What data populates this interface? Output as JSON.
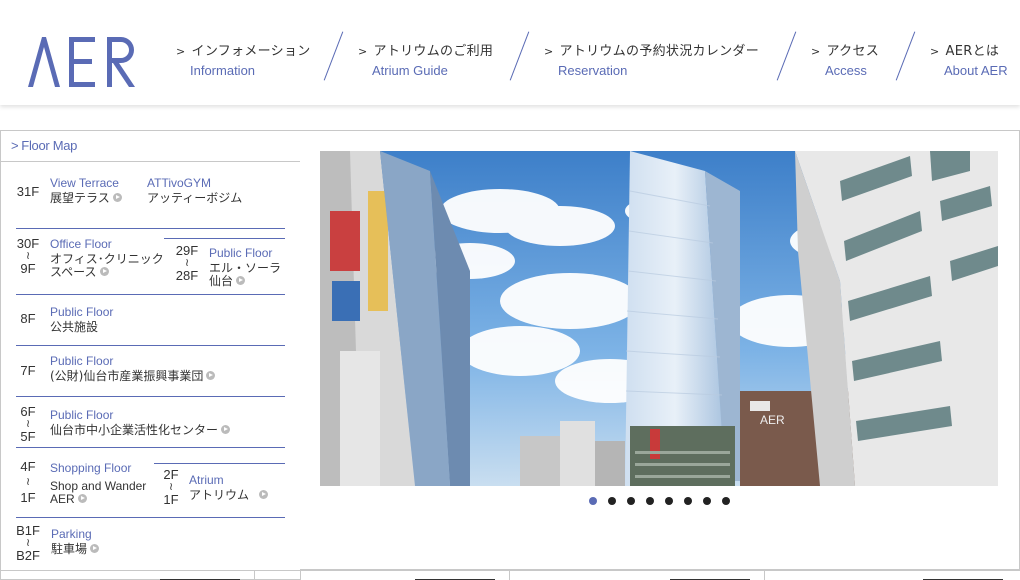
{
  "header": {
    "logo_text": "AER",
    "nav": [
      {
        "jp": "インフォメーション",
        "en": "Information"
      },
      {
        "jp": "アトリウムのご利用",
        "en": "Atrium Guide"
      },
      {
        "jp": "アトリウムの予約状況カレンダー",
        "en": "Reservation"
      },
      {
        "jp": "アクセス",
        "en": "Access"
      },
      {
        "jp": "AERとは",
        "en": "About AER"
      }
    ],
    "nav_arrow": ">"
  },
  "floor_map": {
    "title": "Floor Map",
    "title_arrow": ">",
    "tilde": "≀",
    "f31": {
      "floor": "31F",
      "items": [
        {
          "cat": "View Terrace",
          "name": "展望テラス"
        },
        {
          "cat": "ATTivoGYM",
          "name": "アッティーボジム"
        }
      ]
    },
    "f30": {
      "top": "30F",
      "bottom": "9F",
      "cat": "Office Floor",
      "name1": "オフィス･クリニック",
      "name2": "スペース"
    },
    "f29": {
      "top": "29F",
      "bottom": "28F",
      "cat": "Public Floor",
      "name1": "エル・ソーラ",
      "name2": "仙台"
    },
    "f8": {
      "floor": "8F",
      "cat": "Public Floor",
      "name": "公共施設"
    },
    "f7": {
      "floor": "7F",
      "cat": "Public Floor",
      "name": "(公財)仙台市産業振興事業団"
    },
    "f6": {
      "top": "6F",
      "bottom": "5F",
      "cat": "Public Floor",
      "name": "仙台市中小企業活性化センター"
    },
    "f4": {
      "top": "4F",
      "bottom": "1F",
      "cat": "Shopping Floor",
      "name1": "Shop and Wander",
      "name2": "AER"
    },
    "f2": {
      "top": "2F",
      "bottom": "1F",
      "cat": "Atrium",
      "name": "アトリウム"
    },
    "fb": {
      "top": "B1F",
      "bottom": "B2F",
      "cat": "Parking",
      "name": "駐車場"
    }
  },
  "slider": {
    "building_sign": "AER",
    "dot_count": 8,
    "active_index": 0
  },
  "colors": {
    "accent": "#5a6bb5",
    "border": "#c8c8c8",
    "text": "#333333"
  }
}
